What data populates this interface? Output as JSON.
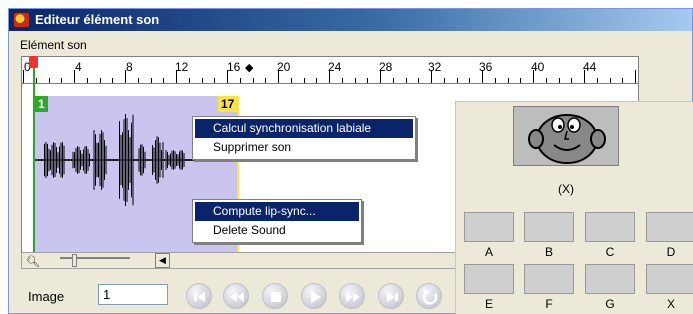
{
  "window": {
    "title": "Editeur élément son"
  },
  "section": {
    "label": "Elément son"
  },
  "ruler": {
    "labels": [
      "0",
      "4",
      "8",
      "12",
      "16",
      "20",
      "24",
      "28",
      "32",
      "36",
      "40",
      "44"
    ]
  },
  "track": {
    "start_frame": "1",
    "end_frame": "17"
  },
  "menu_fr": {
    "items": [
      "Calcul synchronisation labiale",
      "Supprimer son"
    ]
  },
  "menu_en": {
    "items": [
      "Compute lip-sync...",
      "Delete Sound"
    ]
  },
  "image": {
    "label": "Image",
    "value": "1"
  },
  "transport": {
    "buttons": [
      "go-start",
      "rewind",
      "stop",
      "play",
      "fast-forward",
      "go-end",
      "loop"
    ]
  },
  "visemes": {
    "current": "(X)",
    "thumbs": [
      "A",
      "B",
      "C",
      "D",
      "E",
      "F",
      "G",
      "X"
    ]
  },
  "colors": {
    "sound_region": "#c9c5ef",
    "selection": "#0a246a",
    "start_marker": "#2fa827",
    "end_marker": "#ffe14a"
  }
}
